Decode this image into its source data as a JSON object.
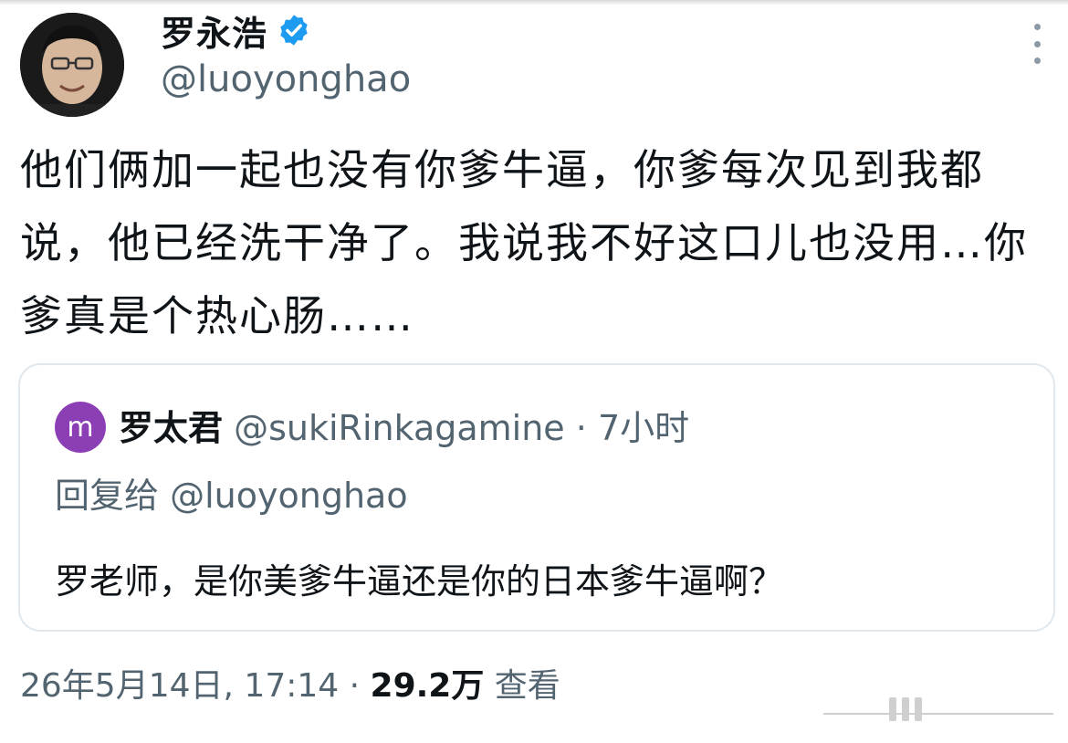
{
  "tweet": {
    "display_name": "罗永浩",
    "handle": "@luoyonghao",
    "verified_icon": "verified-badge-icon",
    "text": "他们俩加一起也没有你爹牛逼，你爹每次见到我都说，他已经洗干净了。我说我不好这口儿也没用…你爹真是个热心肠……",
    "date": "26年5月14日, 17:14",
    "separator": "·",
    "views_count": "29.2万",
    "views_label": "查看"
  },
  "quote": {
    "avatar_letter": "m",
    "display_name": "罗太君",
    "handle": "@sukiRinkagamine",
    "separator": "·",
    "time": "7小时",
    "reply_prefix": "回复给",
    "reply_to": "@luoyonghao",
    "text": "罗老师，是你美爹牛逼还是你的日本爹牛逼啊？"
  },
  "colors": {
    "accent": "#1d9bf0",
    "text_primary": "#0f1419",
    "text_secondary": "#536471",
    "quote_avatar": "#8c3fb5",
    "border": "#e1e8ed"
  }
}
